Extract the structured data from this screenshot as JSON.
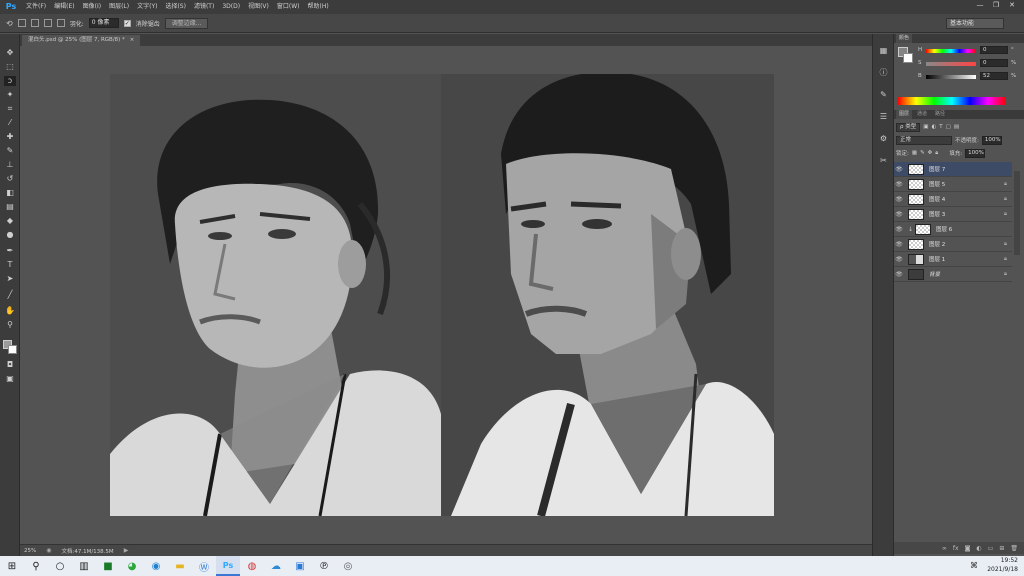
{
  "menubar": {
    "logo": "Ps",
    "items": [
      "文件(F)",
      "编辑(E)",
      "图像(I)",
      "图层(L)",
      "文字(Y)",
      "选择(S)",
      "滤镜(T)",
      "3D(D)",
      "视图(V)",
      "窗口(W)",
      "帮助(H)"
    ],
    "win_min": "—",
    "win_restore": "❐",
    "win_close": "✕"
  },
  "optbar": {
    "feather_label": "羽化:",
    "feather_value": "0 像素",
    "antialias_label": "消除锯齿",
    "refine_edge": "调整边缘...",
    "workspace": "基本功能"
  },
  "doctab": {
    "title": "混白头.psd @ 25% (图层 7, RGB/8) *",
    "close": "×"
  },
  "statusbar": {
    "zoom": "25%",
    "docinfo": "文档:47.1M/138.5M"
  },
  "color_panel": {
    "tabs": [
      "颜色"
    ],
    "rows": [
      {
        "label": "H",
        "value": "0",
        "unit": "°"
      },
      {
        "label": "S",
        "value": "0",
        "unit": "%"
      },
      {
        "label": "B",
        "value": "52",
        "unit": "%"
      }
    ],
    "fg": "#848484"
  },
  "layers_panel": {
    "tabs": [
      "图层",
      "通道",
      "路径"
    ],
    "filter_label": "ρ 类型",
    "blend_mode": "正常",
    "opacity_label": "不透明度:",
    "opacity_value": "100%",
    "lock_label": "锁定:",
    "fill_label": "填充:",
    "fill_value": "100%",
    "layers": [
      {
        "name": "图层 7",
        "selected": true,
        "locked": false,
        "thumb": "checker"
      },
      {
        "name": "图层 5",
        "selected": false,
        "locked": true,
        "thumb": "checker"
      },
      {
        "name": "图层 4",
        "selected": false,
        "locked": true,
        "thumb": "checker"
      },
      {
        "name": "图层 3",
        "selected": false,
        "locked": true,
        "thumb": "checker"
      },
      {
        "name": "图层 6",
        "selected": false,
        "locked": false,
        "thumb": "checker",
        "clipped": true
      },
      {
        "name": "图层 2",
        "selected": false,
        "locked": true,
        "thumb": "checker"
      },
      {
        "name": "图层 1",
        "selected": false,
        "locked": true,
        "thumb": "photo"
      },
      {
        "name": "背景",
        "selected": false,
        "locked": true,
        "thumb": "gray"
      }
    ]
  },
  "taskbar": {
    "time": "19:52",
    "date": "2021/9/18"
  }
}
